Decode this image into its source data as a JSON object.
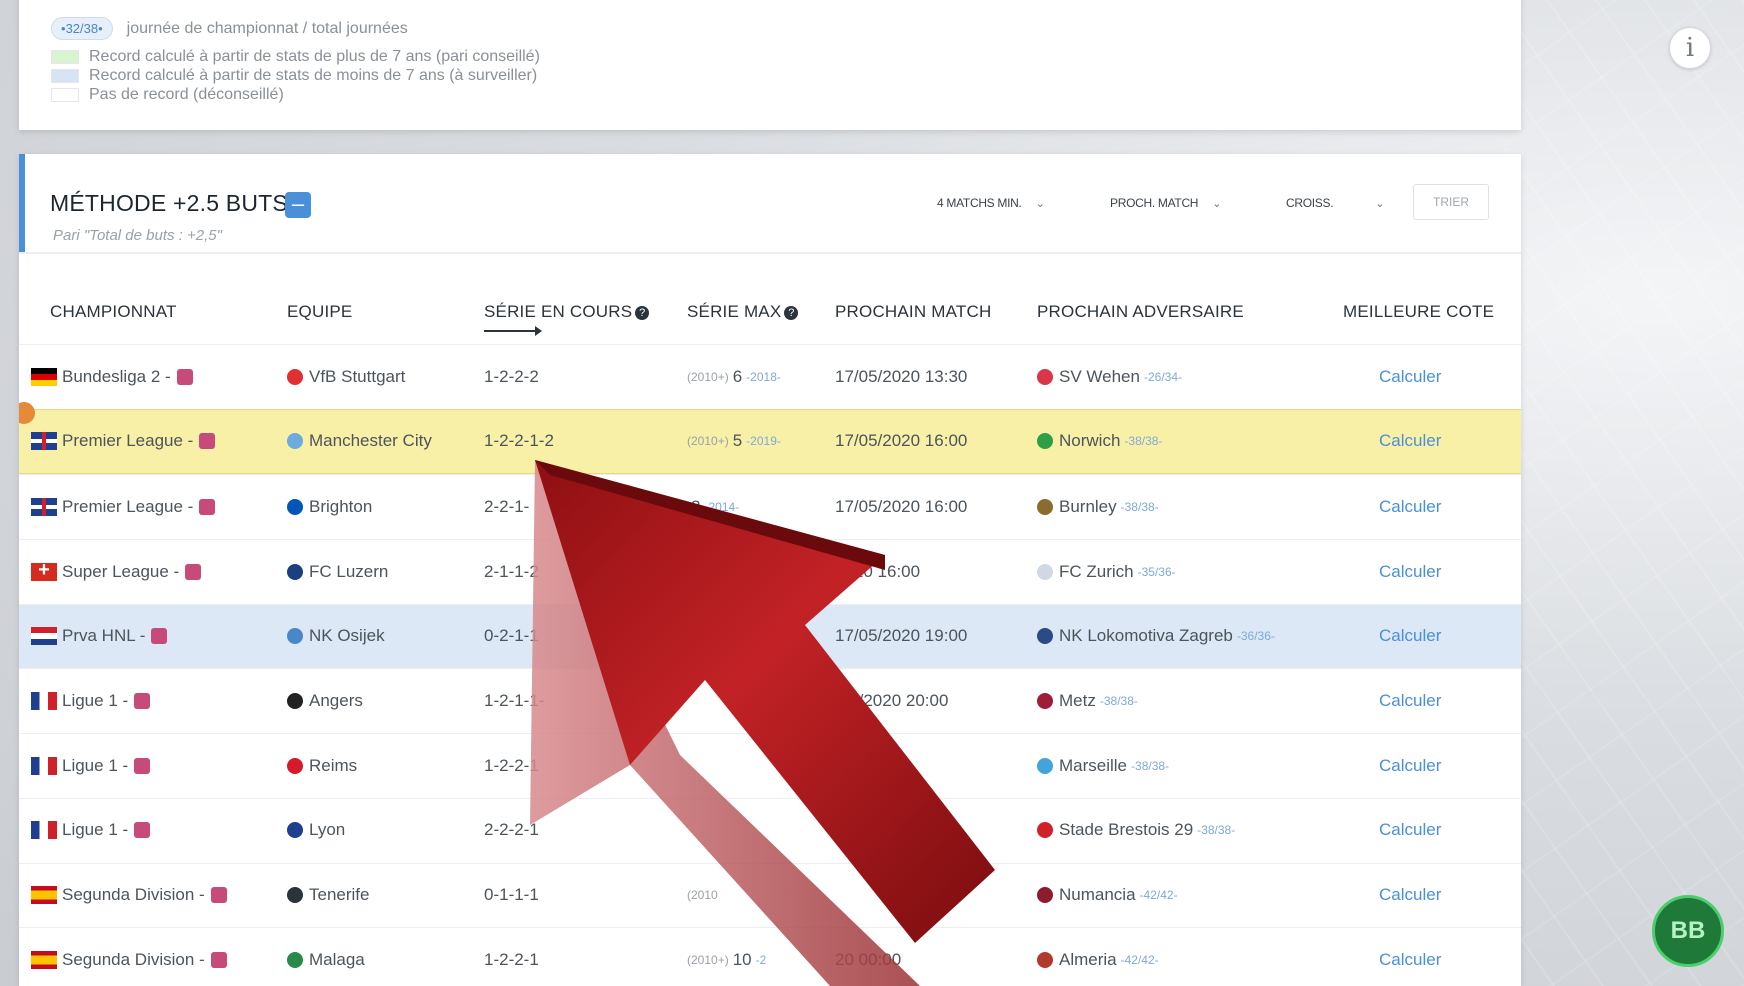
{
  "legend": {
    "pill_label": "32/38",
    "pill_desc": "journée de championnat / total journées",
    "items": [
      {
        "color": "#d9f5d0",
        "label": "Record calculé à partir de stats de plus de 7 ans (pari conseillé)"
      },
      {
        "color": "#d6e4f4",
        "label": "Record calculé à partir de stats de moins de 7 ans (à surveiller)"
      },
      {
        "color": "#ffffff",
        "label": "Pas de record (déconseillé)"
      }
    ]
  },
  "method": {
    "title": "MÉTHODE +2.5 BUTS",
    "collapse_symbol": "–",
    "subtitle": "Pari \"Total de buts : +2,5\"",
    "filters": [
      "4 MATCHS MIN.",
      "PROCH. MATCH",
      "CROISS."
    ],
    "sort_button": "TRIER"
  },
  "table": {
    "headers": [
      "CHAMPIONNAT",
      "EQUIPE",
      "SÉRIE EN COURS",
      "SÉRIE MAX",
      "PROCHAIN MATCH",
      "PROCHAIN ADVERSAIRE",
      "MEILLEURE COTE"
    ],
    "help_symbol": "?",
    "rows": [
      {
        "flag": "de",
        "league": "Bundesliga 2 -",
        "team": "VfB Stuttgart",
        "team_color": "#e03030",
        "series": "1-2-2-2",
        "max_prefix": "(2010+)",
        "max": "6",
        "max_year": "-2018-",
        "next_match": "17/05/2020 13:30",
        "opponent": "SV Wehen",
        "opp_round": "-26/34-",
        "opp_color": "#d9364a",
        "action": "Calculer",
        "highlight": ""
      },
      {
        "flag": "gb",
        "league": "Premier League -",
        "team": "Manchester City",
        "team_color": "#6cabdd",
        "series": "1-2-2-1-2",
        "max_prefix": "(2010+)",
        "max": "5",
        "max_year": "-2019-",
        "next_match": "17/05/2020 16:00",
        "opponent": "Norwich",
        "opp_round": "-38/38-",
        "opp_color": "#2f9e44",
        "action": "Calculer",
        "highlight": "yellow"
      },
      {
        "flag": "gb",
        "league": "Premier League -",
        "team": "Brighton",
        "team_color": "#0057b8",
        "series": "2-2-1-",
        "max_prefix": "",
        "max": "8",
        "max_year": "-2014-",
        "next_match": "17/05/2020 16:00",
        "opponent": "Burnley",
        "opp_round": "-38/38-",
        "opp_color": "#8b6b2e",
        "action": "Calculer",
        "highlight": ""
      },
      {
        "flag": "ch",
        "league": "Super League -",
        "team": "FC Luzern",
        "team_color": "#1c3f80",
        "series": "2-1-1-2",
        "max_prefix": "",
        "max": "",
        "max_year": "",
        "next_match": "2020 16:00",
        "opponent": "FC Zurich",
        "opp_round": "-35/36-",
        "opp_color": "#cfd8e3",
        "action": "Calculer",
        "highlight": ""
      },
      {
        "flag": "hr",
        "league": "Prva HNL -",
        "team": "NK Osijek",
        "team_color": "#4a86c8",
        "series": "0-2-1-1",
        "max_prefix": "",
        "max": "",
        "max_year": "",
        "next_match": "17/05/2020 19:00",
        "opponent": "NK Lokomotiva Zagreb",
        "opp_round": "-36/36-",
        "opp_color": "#2c4a86",
        "action": "Calculer",
        "highlight": "blue"
      },
      {
        "flag": "fr",
        "league": "Ligue 1 -",
        "team": "Angers",
        "team_color": "#222222",
        "series": "1-2-1-1-",
        "max_prefix": "",
        "max": "",
        "max_year": "",
        "next_match": "/05/2020 20:00",
        "opponent": "Metz",
        "opp_round": "-38/38-",
        "opp_color": "#a01d3a",
        "action": "Calculer",
        "highlight": ""
      },
      {
        "flag": "fr",
        "league": "Ligue 1 -",
        "team": "Reims",
        "team_color": "#d7192c",
        "series": "1-2-2-1",
        "max_prefix": "",
        "max": "",
        "max_year": "",
        "next_match": "20 20:00",
        "opponent": "Marseille",
        "opp_round": "-38/38-",
        "opp_color": "#44a3d8",
        "action": "Calculer",
        "highlight": ""
      },
      {
        "flag": "fr",
        "league": "Ligue 1 -",
        "team": "Lyon",
        "team_color": "#1f3f8f",
        "series": "2-2-2-1",
        "max_prefix": "",
        "max": "",
        "max_year": "",
        "next_match": "00",
        "opponent": "Stade Brestois 29",
        "opp_round": "-38/38-",
        "opp_color": "#d0212a",
        "action": "Calculer",
        "highlight": ""
      },
      {
        "flag": "es",
        "league": "Segunda Division -",
        "team": "Tenerife",
        "team_color": "#2b333b",
        "series": "0-1-1-1",
        "max_prefix": "(2010",
        "max": "",
        "max_year": "",
        "next_match": "",
        "opponent": "Numancia",
        "opp_round": "-42/42-",
        "opp_color": "#8c1c2e",
        "action": "Calculer",
        "highlight": ""
      },
      {
        "flag": "es",
        "league": "Segunda Division -",
        "team": "Malaga",
        "team_color": "#2a8a4a",
        "series": "1-2-2-1",
        "max_prefix": "(2010+)",
        "max": "10",
        "max_year": "-2",
        "next_match": "20 00:00",
        "opponent": "Almeria",
        "opp_round": "-42/42-",
        "opp_color": "#b03a2e",
        "action": "Calculer",
        "highlight": ""
      }
    ]
  },
  "overlay": {
    "info_symbol": "i",
    "logo_text": "BB"
  },
  "colors": {
    "accent": "#4a90d9",
    "highlight_yellow": "#f9f0a8",
    "highlight_blue": "#dce8f5",
    "arrow_red": "#a5161a"
  }
}
